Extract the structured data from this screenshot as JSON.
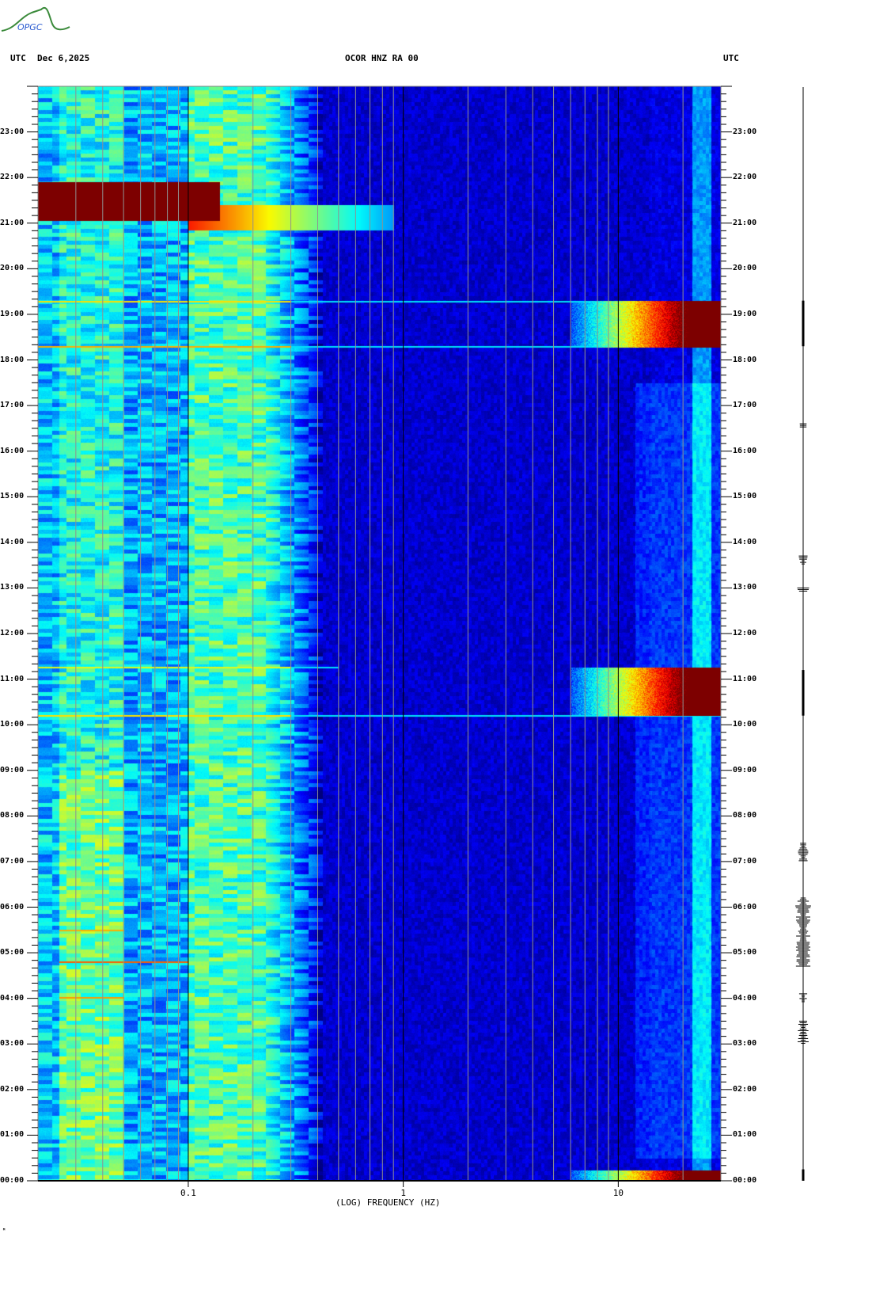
{
  "header": {
    "left_label": "UTC",
    "date": "Dec 6,2025",
    "station": "OCOR HNZ RA 00",
    "right_label": "UTC",
    "logo_text": "OPGC",
    "footer_mark": "ᴹ"
  },
  "chart_data": {
    "type": "heatmap",
    "title": "OCOR HNZ RA 00",
    "xlabel": "(LOG) FREQUENCY (HZ)",
    "ylabel": "UTC",
    "x_scale": "log",
    "xlim": [
      0.02,
      30
    ],
    "ylim_hours": [
      0,
      24
    ],
    "x_ticks": [
      {
        "value": 0.1,
        "label": "0.1"
      },
      {
        "value": 1,
        "label": "1"
      },
      {
        "value": 10,
        "label": "10"
      }
    ],
    "x_gridlines": [
      0.03,
      0.04,
      0.05,
      0.06,
      0.07,
      0.08,
      0.09,
      0.1,
      0.2,
      0.3,
      0.4,
      0.5,
      0.6,
      0.7,
      0.8,
      0.9,
      1,
      2,
      3,
      4,
      5,
      6,
      7,
      8,
      9,
      10,
      20
    ],
    "y_ticks": [
      "00:00",
      "01:00",
      "02:00",
      "03:00",
      "04:00",
      "05:00",
      "06:00",
      "07:00",
      "08:00",
      "09:00",
      "10:00",
      "11:00",
      "12:00",
      "13:00",
      "14:00",
      "15:00",
      "16:00",
      "17:00",
      "18:00",
      "19:00",
      "20:00",
      "21:00",
      "22:00",
      "23:00"
    ],
    "colormap": "jet",
    "events": [
      {
        "name": "low-frequency-burst",
        "t_start": 21.05,
        "t_end": 21.9,
        "f_min": 0.02,
        "f_max": 0.14,
        "level": 1.0
      },
      {
        "name": "low-frequency-tail",
        "t_start": 20.85,
        "t_end": 21.4,
        "f_min": 0.1,
        "f_max": 0.9,
        "level": 0.55
      },
      {
        "name": "high-frequency-event",
        "t_start": 18.28,
        "t_end": 19.3,
        "f_min": 6,
        "f_max": 30,
        "level": 1.0
      },
      {
        "name": "high-frequency-event",
        "t_start": 10.2,
        "t_end": 11.27,
        "f_min": 6,
        "f_max": 30,
        "level": 1.0
      },
      {
        "name": "high-frequency-event",
        "t_start": 0.0,
        "t_end": 0.23,
        "f_min": 6,
        "f_max": 30,
        "level": 0.95
      },
      {
        "name": "broadband-line",
        "t_start": 18.28,
        "t_end": 18.32,
        "f_min": 0.02,
        "f_max": 30,
        "level": 0.7
      },
      {
        "name": "broadband-line",
        "t_start": 19.27,
        "t_end": 19.31,
        "f_min": 0.02,
        "f_max": 30,
        "level": 0.65
      },
      {
        "name": "broadband-line",
        "t_start": 10.18,
        "t_end": 10.22,
        "f_min": 0.02,
        "f_max": 30,
        "level": 0.65
      },
      {
        "name": "broadband-line",
        "t_start": 11.25,
        "t_end": 11.28,
        "f_min": 0.02,
        "f_max": 0.5,
        "level": 0.6
      },
      {
        "name": "low-frequency-line",
        "t_start": 4.78,
        "t_end": 4.82,
        "f_min": 0.025,
        "f_max": 0.1,
        "level": 0.78
      },
      {
        "name": "low-frequency-line",
        "t_start": 4.0,
        "t_end": 4.04,
        "f_min": 0.025,
        "f_max": 0.05,
        "level": 0.72
      },
      {
        "name": "low-frequency-line",
        "t_start": 5.48,
        "t_end": 5.52,
        "f_min": 0.025,
        "f_max": 0.05,
        "level": 0.7
      }
    ],
    "trace_bursts": [
      {
        "t": 19.3,
        "t_end": 18.3,
        "amp": 2
      },
      {
        "t": 11.2,
        "t_end": 10.2,
        "amp": 2
      },
      {
        "t": 16.6,
        "t_end": 16.5,
        "amp": 6
      },
      {
        "t": 13.7,
        "t_end": 13.5,
        "amp": 6
      },
      {
        "t": 13.0,
        "t_end": 12.9,
        "amp": 8
      },
      {
        "t": 7.4,
        "t_end": 7.0,
        "amp": 7
      },
      {
        "t": 6.2,
        "t_end": 4.7,
        "amp": 10
      },
      {
        "t": 4.1,
        "t_end": 3.9,
        "amp": 6
      },
      {
        "t": 3.5,
        "t_end": 3.0,
        "amp": 7
      },
      {
        "t": 0.25,
        "t_end": 0.0,
        "amp": 2
      }
    ]
  }
}
